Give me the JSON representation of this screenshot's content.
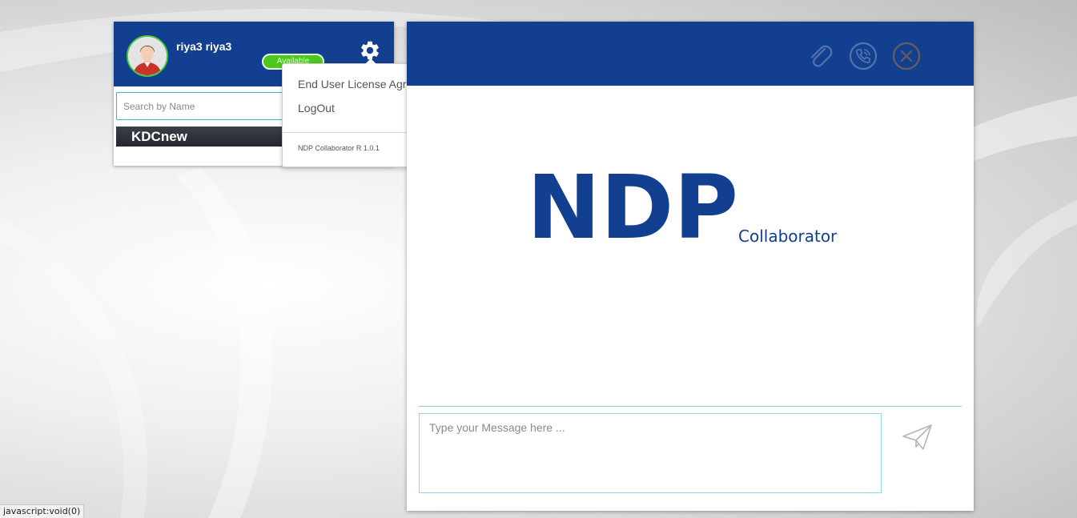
{
  "user": {
    "name": "riya3 riya3",
    "status": "Available"
  },
  "contacts": {
    "search_placeholder": "Search by Name",
    "groups": [
      {
        "label": "KDCnew"
      }
    ]
  },
  "settings_menu": {
    "items": [
      {
        "label": "End User License Agreement"
      },
      {
        "label": "LogOut",
        "icon": "power-icon"
      }
    ],
    "version": "NDP Collaborator R 1.0.1"
  },
  "chat": {
    "header_icons": [
      "paperclip-icon",
      "phone-call-icon",
      "close-icon"
    ],
    "logo_main": "NDP",
    "logo_sub": "Collaborator",
    "message_placeholder": "Type your Message here ...",
    "send_icon": "send-icon"
  },
  "status_bar": {
    "text": "javascript:void(0)"
  },
  "colors": {
    "brand_blue": "#123f8f",
    "available_green": "#4ac81e",
    "input_border": "#8ed8e8"
  }
}
